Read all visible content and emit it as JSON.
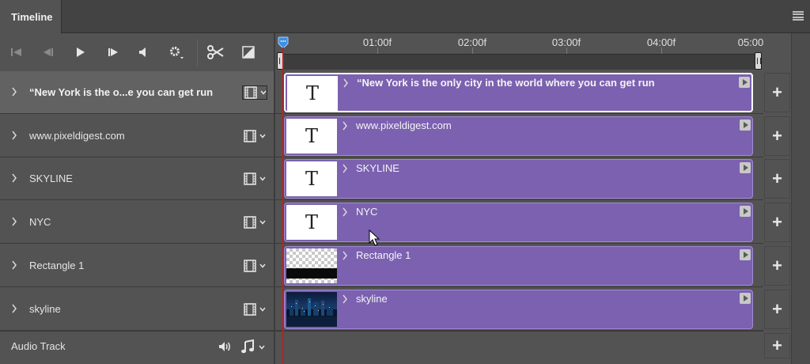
{
  "panel": {
    "tab_label": "Timeline",
    "menu_icon": "hamburger-menu-icon"
  },
  "toolbar": {
    "buttons": [
      {
        "name": "go-to-first-frame-button",
        "icon": "skip-to-start-icon"
      },
      {
        "name": "previous-frame-button",
        "icon": "step-back-icon"
      },
      {
        "name": "play-button",
        "icon": "play-icon"
      },
      {
        "name": "next-frame-button",
        "icon": "step-forward-icon"
      },
      {
        "name": "mute-audio-button",
        "icon": "speaker-icon"
      },
      {
        "name": "playback-settings-button",
        "icon": "gear-icon"
      },
      {
        "name": "split-at-playhead-button",
        "icon": "scissors-icon"
      },
      {
        "name": "transition-button",
        "icon": "transition-icon"
      }
    ]
  },
  "ruler": {
    "labels": [
      "01:00f",
      "02:00f",
      "03:00f",
      "04:00f",
      "05:00"
    ]
  },
  "layers": [
    {
      "name": "“New York is the o...e you can get run",
      "clip_label": "“New York is the only city in  the world where you can get run",
      "thumb": "text",
      "selected": true
    },
    {
      "name": "www.pixeldigest.com",
      "clip_label": "www.pixeldigest.com",
      "thumb": "text",
      "selected": false
    },
    {
      "name": "SKYLINE",
      "clip_label": "SKYLINE",
      "thumb": "text",
      "selected": false
    },
    {
      "name": "NYC",
      "clip_label": "NYC",
      "thumb": "text",
      "selected": false
    },
    {
      "name": "Rectangle 1",
      "clip_label": "Rectangle 1",
      "thumb": "rectangle",
      "selected": false
    },
    {
      "name": "skyline",
      "clip_label": "skyline",
      "thumb": "photo",
      "selected": false
    }
  ],
  "text_thumb_glyph": "T",
  "audio_track": {
    "label": "Audio Track"
  },
  "add_label": "+",
  "colors": {
    "clip_fill": "#7b61b0",
    "clip_border": "#a48ad6",
    "playhead": "#c21d1d",
    "panel_bg": "#535353",
    "playhead_handle": "#3d8fe0"
  }
}
